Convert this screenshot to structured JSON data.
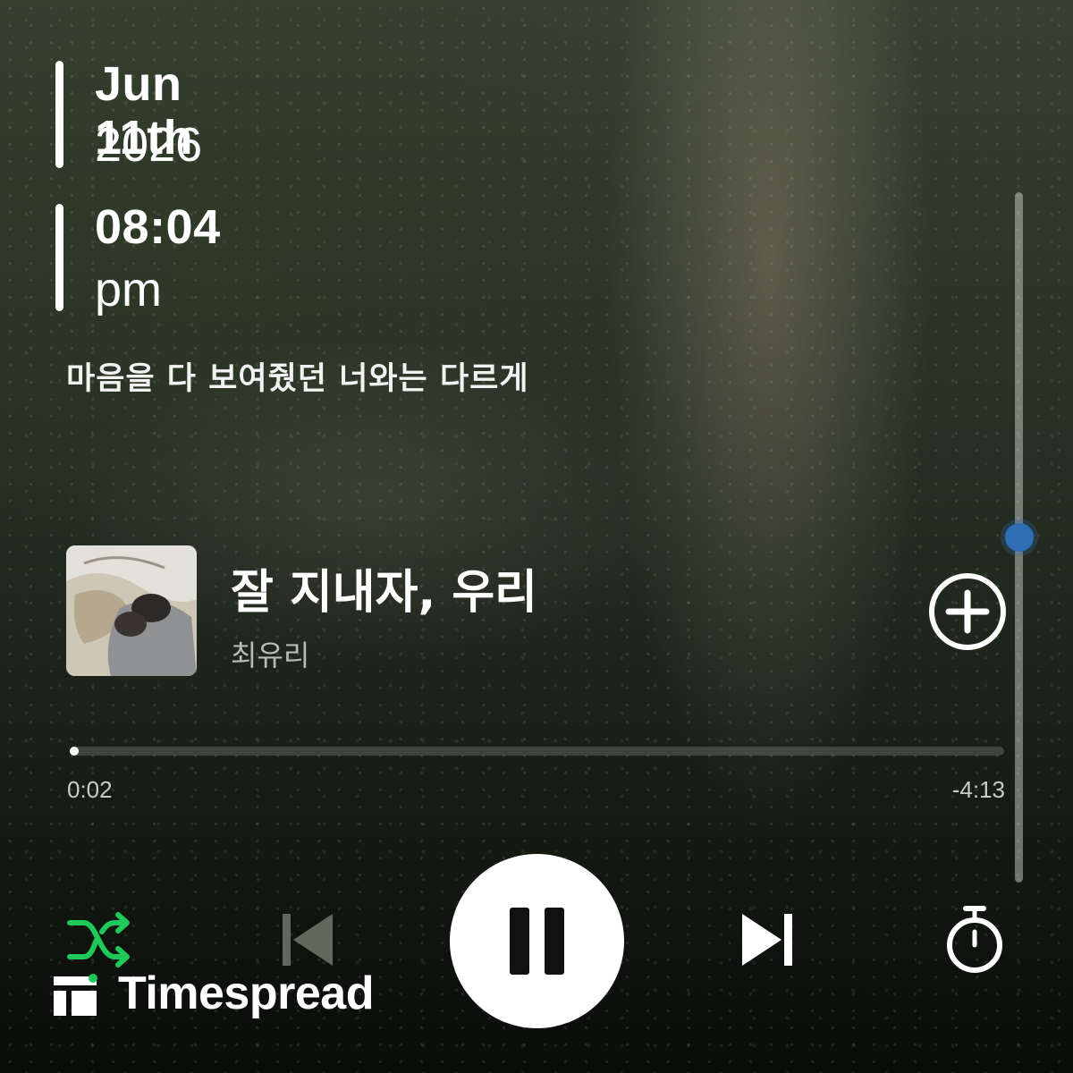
{
  "clock": {
    "date": "Jun 11th",
    "year": "2026",
    "time": "08:04",
    "period": "pm"
  },
  "lyric": "마음을 다 보여줬던 너와는 다르게",
  "track": {
    "title": "잘 지내자, 우리",
    "artist": "최유리"
  },
  "progress": {
    "elapsed": "0:02",
    "remaining": "-4:13",
    "fraction": 0.008
  },
  "volume": {
    "level": 0.5
  },
  "controls": {
    "shuffle_icon": "shuffle-icon",
    "prev_icon": "skip-previous-icon",
    "play_pause_icon": "pause-icon",
    "next_icon": "skip-next-icon",
    "timer_icon": "timer-icon",
    "add_icon": "add-circle-icon"
  },
  "colors": {
    "shuffle_active": "#1ec95a",
    "volume_thumb": "#2f6db5",
    "text_primary": "#ffffff",
    "text_secondary": "#b8bcb4"
  },
  "brand": {
    "name": "Timespread"
  }
}
